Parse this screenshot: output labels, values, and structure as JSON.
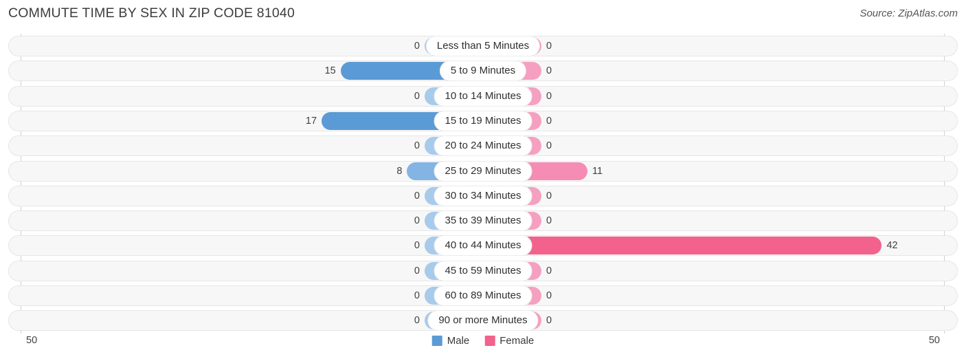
{
  "header": {
    "title": "COMMUTE TIME BY SEX IN ZIP CODE 81040",
    "source": "Source: ZipAtlas.com"
  },
  "legend": {
    "male_label": "Male",
    "female_label": "Female",
    "male_color": "#5b9bd5",
    "female_color": "#f2628c"
  },
  "axis": {
    "left_tick": "50",
    "right_tick": "50",
    "max": 50
  },
  "colors": {
    "male_strong": "#5b9bd5",
    "male_mid": "#83b4e3",
    "male_zero": "#a8cbec",
    "female_strong": "#f2628c",
    "female_mid": "#f58cb4",
    "female_zero": "#f5a0c0",
    "track_bg": "#f7f7f7",
    "track_border": "#e6e6e6",
    "axis_line": "#cfcfcf"
  },
  "chart_data": {
    "type": "bar",
    "orientation": "horizontal",
    "style": "diverging-population-pyramid",
    "title": "COMMUTE TIME BY SEX IN ZIP CODE 81040",
    "xlabel": "",
    "ylabel": "",
    "xlim": [
      50,
      50
    ],
    "grid": false,
    "legend_position": "bottom-center",
    "categories": [
      "Less than 5 Minutes",
      "5 to 9 Minutes",
      "10 to 14 Minutes",
      "15 to 19 Minutes",
      "20 to 24 Minutes",
      "25 to 29 Minutes",
      "30 to 34 Minutes",
      "35 to 39 Minutes",
      "40 to 44 Minutes",
      "45 to 59 Minutes",
      "60 to 89 Minutes",
      "90 or more Minutes"
    ],
    "series": [
      {
        "name": "Male",
        "color": "#5b9bd5",
        "values": [
          0,
          15,
          0,
          17,
          0,
          8,
          0,
          0,
          0,
          0,
          0,
          0
        ]
      },
      {
        "name": "Female",
        "color": "#f2628c",
        "values": [
          0,
          0,
          0,
          0,
          0,
          11,
          0,
          0,
          42,
          0,
          0,
          0
        ]
      }
    ]
  },
  "rows": [
    {
      "label": "Less than 5 Minutes",
      "male": 0,
      "male_text": "0",
      "female": 0,
      "female_text": "0"
    },
    {
      "label": "5 to 9 Minutes",
      "male": 15,
      "male_text": "15",
      "female": 0,
      "female_text": "0"
    },
    {
      "label": "10 to 14 Minutes",
      "male": 0,
      "male_text": "0",
      "female": 0,
      "female_text": "0"
    },
    {
      "label": "15 to 19 Minutes",
      "male": 17,
      "male_text": "17",
      "female": 0,
      "female_text": "0"
    },
    {
      "label": "20 to 24 Minutes",
      "male": 0,
      "male_text": "0",
      "female": 0,
      "female_text": "0"
    },
    {
      "label": "25 to 29 Minutes",
      "male": 8,
      "male_text": "8",
      "female": 11,
      "female_text": "11"
    },
    {
      "label": "30 to 34 Minutes",
      "male": 0,
      "male_text": "0",
      "female": 0,
      "female_text": "0"
    },
    {
      "label": "35 to 39 Minutes",
      "male": 0,
      "male_text": "0",
      "female": 0,
      "female_text": "0"
    },
    {
      "label": "40 to 44 Minutes",
      "male": 0,
      "male_text": "0",
      "female": 42,
      "female_text": "42"
    },
    {
      "label": "45 to 59 Minutes",
      "male": 0,
      "male_text": "0",
      "female": 0,
      "female_text": "0"
    },
    {
      "label": "60 to 89 Minutes",
      "male": 0,
      "male_text": "0",
      "female": 0,
      "female_text": "0"
    },
    {
      "label": "90 or more Minutes",
      "male": 0,
      "male_text": "0",
      "female": 0,
      "female_text": "0"
    }
  ]
}
